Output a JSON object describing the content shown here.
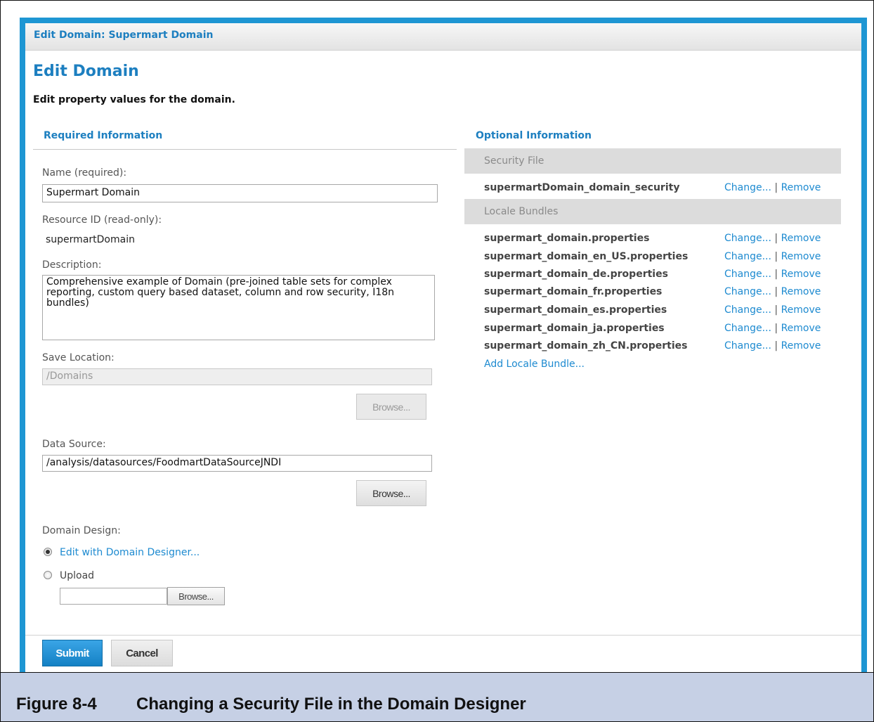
{
  "header": {
    "title": "Edit Domain: Supermart Domain"
  },
  "page": {
    "title": "Edit Domain",
    "subtitle": "Edit property values for the domain."
  },
  "required": {
    "heading": "Required Information",
    "name_label": "Name (required):",
    "name_value": "Supermart Domain",
    "resource_id_label": "Resource ID (read-only):",
    "resource_id_value": "supermartDomain",
    "description_label": "Description:",
    "description_value": "Comprehensive example of Domain (pre-joined table sets for complex reporting, custom query based dataset, column and row security, I18n bundles)",
    "save_location_label": "Save Location:",
    "save_location_value": "/Domains",
    "browse_label": "Browse...",
    "data_source_label": "Data Source:",
    "data_source_value": "/analysis/datasources/FoodmartDataSourceJNDI",
    "domain_design_label": "Domain Design:",
    "edit_with_designer_label": "Edit with Domain Designer...",
    "upload_label": "Upload",
    "upload_value": ""
  },
  "optional": {
    "heading": "Optional Information",
    "security_file_heading": "Security File",
    "security_file": "supermartDomain_domain_security",
    "locale_bundles_heading": "Locale Bundles",
    "locale_bundles": [
      "supermart_domain.properties",
      "supermart_domain_en_US.properties",
      "supermart_domain_de.properties",
      "supermart_domain_fr.properties",
      "supermart_domain_es.properties",
      "supermart_domain_ja.properties",
      "supermart_domain_zh_CN.properties"
    ],
    "change_label": "Change...",
    "separator": "|",
    "remove_label": "Remove",
    "add_locale_bundle_label": "Add Locale Bundle..."
  },
  "footer": {
    "submit_label": "Submit",
    "cancel_label": "Cancel"
  },
  "caption": {
    "number": "Figure 8-4",
    "text": "Changing a Security File in the Domain Designer"
  }
}
